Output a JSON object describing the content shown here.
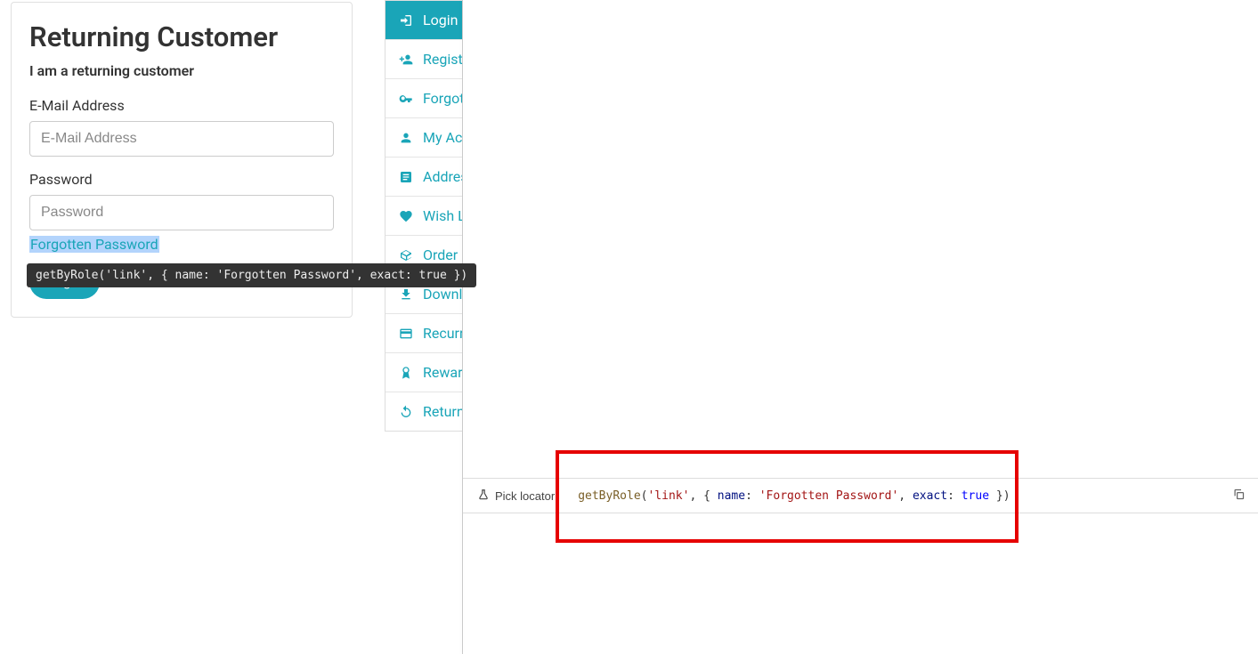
{
  "card": {
    "title": "Returning Customer",
    "subtitle": "I am a returning customer",
    "email_label": "E-Mail Address",
    "email_placeholder": "E-Mail Address",
    "password_label": "Password",
    "password_placeholder": "Password",
    "forgot_link": "Forgotten Password",
    "login_button": "Login"
  },
  "tooltip": {
    "text": "getByRole('link', { name: 'Forgotten Password', exact: true })"
  },
  "sidebar": {
    "items": [
      {
        "icon": "login-icon",
        "label": "Login",
        "active": true
      },
      {
        "icon": "user-plus-icon",
        "label": "Register",
        "active": false
      },
      {
        "icon": "key-icon",
        "label": "Forgotten Password",
        "active": false
      },
      {
        "icon": "user-icon",
        "label": "My Account",
        "active": false
      },
      {
        "icon": "address-book-icon",
        "label": "Address Book",
        "active": false
      },
      {
        "icon": "heart-icon",
        "label": "Wish List",
        "active": false
      },
      {
        "icon": "box-icon",
        "label": "Order History",
        "active": false
      },
      {
        "icon": "download-icon",
        "label": "Downloads",
        "active": false
      },
      {
        "icon": "credit-card-icon",
        "label": "Recurring payments",
        "active": false
      },
      {
        "icon": "reward-icon",
        "label": "Reward Points",
        "active": false
      },
      {
        "icon": "return-icon",
        "label": "Returns",
        "active": false
      }
    ]
  },
  "locator_bar": {
    "pick_label": "Pick locator",
    "code": {
      "fn": "getByRole",
      "arg1": "'link'",
      "name_key": "name",
      "name_val": "'Forgotten Password'",
      "exact_key": "exact",
      "exact_val": "true"
    }
  }
}
